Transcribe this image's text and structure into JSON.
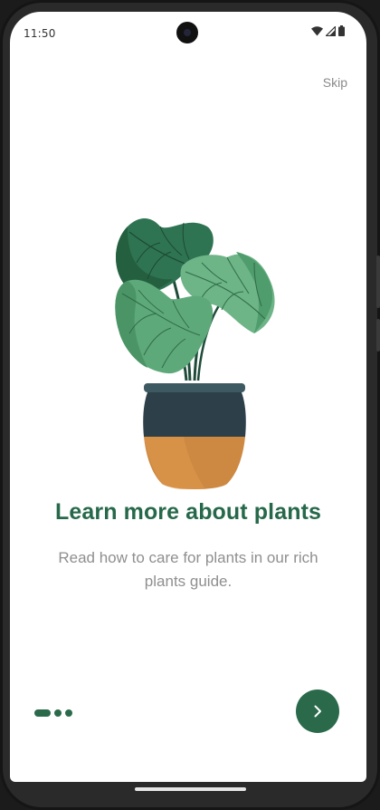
{
  "status_bar": {
    "time": "11:50",
    "icons": [
      "wifi-icon",
      "signal-icon",
      "battery-icon"
    ]
  },
  "onboarding": {
    "skip_label": "Skip",
    "title": "Learn more about plants",
    "description": "Read how to care for plants in our rich plants guide.",
    "illustration": "potted-plant-illustration",
    "pager": {
      "current_page": 1,
      "total_pages": 3
    },
    "next_button_icon": "chevron-right-icon"
  },
  "colors": {
    "accent": "#2a6a4b",
    "title": "#26684a",
    "description": "#8f8f8f",
    "skip": "#8a8a8a",
    "pot_top": "#2e414a",
    "pot_bottom": "#cf8a45",
    "leaf_dark": "#2c7350",
    "leaf_light": "#6fb486"
  }
}
